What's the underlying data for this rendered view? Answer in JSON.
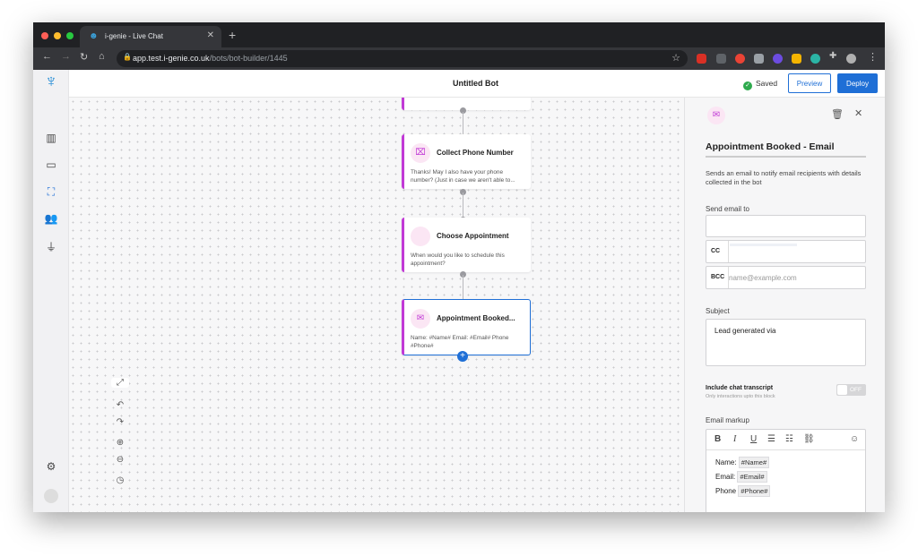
{
  "browser": {
    "tab_title": "i-genie - Live Chat",
    "url_host": "app.test.i-genie.co.uk",
    "url_path": "/bots/bot-builder/1445"
  },
  "header": {
    "title": "Untitled Bot",
    "status": "Saved",
    "preview_label": "Preview",
    "deploy_label": "Deploy"
  },
  "flow": {
    "nodes": [
      {
        "title": "Collect Phone Number",
        "desc": "Thanks! May I also have your phone number? (Just in case we aren't able to..."
      },
      {
        "title": "Choose Appointment",
        "desc": "When would you like to schedule this appointment?"
      },
      {
        "title": "Appointment Booked...",
        "desc": "Name: #Name# Email: #Email# Phone #Phone#"
      }
    ]
  },
  "panel": {
    "title": "Appointment Booked - Email",
    "description": "Sends an email to notify email recipients with details collected in the bot",
    "send_to_label": "Send email to",
    "cc_label": "CC",
    "bcc_label": "BCC",
    "bcc_placeholder": "name@example.com",
    "subject_label": "Subject",
    "subject_value": "Lead generated via",
    "transcript_label": "Include chat transcript",
    "transcript_hint": "Only interactions upto this block",
    "transcript_toggle": "OFF",
    "markup_label": "Email markup",
    "markup_lines": [
      {
        "label": "Name:",
        "tag": "#Name#"
      },
      {
        "label": "Email:",
        "tag": "#Email#"
      },
      {
        "label": "Phone",
        "tag": "#Phone#"
      }
    ]
  },
  "colors": {
    "accent": "#1f6fd6",
    "node_border": "#c13ad6",
    "saved_green": "#2eaa4d"
  }
}
